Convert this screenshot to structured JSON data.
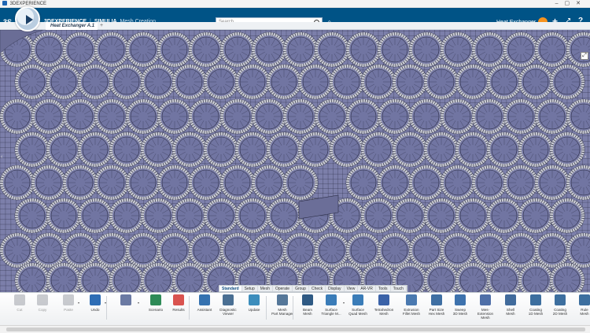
{
  "os_window": {
    "title": "3DEXPERIENCE"
  },
  "header": {
    "ds_logo": "3S",
    "brand_bold": "3DEXPERIENCE",
    "separator": "|",
    "brand_product": "SIMULIA",
    "app_name": "Mesh Creation",
    "search_placeholder": "Search",
    "space_title": "Heat Exchanger",
    "icons": [
      "compass-icon",
      "search-icon",
      "tag-icon",
      "user-avatar-icon",
      "add-icon",
      "share-icon",
      "help-icon"
    ],
    "colors": {
      "bar": "#005386",
      "avatar": "#f7931e"
    }
  },
  "document_tab": {
    "label": "Heat Exchanger A.1",
    "add_symbol": "+"
  },
  "viewport": {
    "model": "heat exchanger tube sheet mesh",
    "colors": {
      "mesh_fill": "#7c7faa",
      "mesh_line": "#2a2c45",
      "tube_ring": "#c9cbd4"
    }
  },
  "action_tabs": [
    {
      "label": "Standard",
      "active": true
    },
    {
      "label": "Setup",
      "active": false
    },
    {
      "label": "Mesh",
      "active": false
    },
    {
      "label": "Operate",
      "active": false
    },
    {
      "label": "Group",
      "active": false
    },
    {
      "label": "Check",
      "active": false
    },
    {
      "label": "Display",
      "active": false
    },
    {
      "label": "View",
      "active": false
    },
    {
      "label": "AR-VR",
      "active": false
    },
    {
      "label": "Tools",
      "active": false
    },
    {
      "label": "Touch",
      "active": false
    }
  ],
  "toolbar": {
    "tools": [
      {
        "label": "Cut",
        "icon": "scissors-icon",
        "disabled": true
      },
      {
        "label": "Copy",
        "icon": "copy-icon",
        "disabled": true
      },
      {
        "label": "Paste",
        "icon": "paste-icon",
        "disabled": true
      },
      {
        "label": "Undo",
        "icon": "undo-icon",
        "disabled": false
      },
      {
        "label": "",
        "icon": "shape-icon",
        "disabled": false
      },
      {
        "label": "Scenario",
        "icon": "scenario-icon",
        "disabled": false
      },
      {
        "label": "Results",
        "icon": "results-icon",
        "disabled": false
      },
      {
        "label": "Assistant",
        "icon": "assistant-icon",
        "disabled": false
      },
      {
        "label": "Diagnostic\nViewer",
        "icon": "diagnostic-icon",
        "disabled": false
      },
      {
        "label": "Update",
        "icon": "update-icon",
        "disabled": false
      },
      {
        "label": "Mesh\nPart Manager",
        "icon": "mesh-part-manager-icon",
        "disabled": false
      },
      {
        "label": "Beam\nMesh",
        "icon": "beam-mesh-icon",
        "disabled": false
      },
      {
        "label": "Surface\nTriangle M...",
        "icon": "surface-triangle-mesh-icon",
        "disabled": false
      },
      {
        "label": "Surface\nQuad Mesh",
        "icon": "surface-quad-mesh-icon",
        "disabled": false
      },
      {
        "label": "Tetrahedron\nMesh",
        "icon": "tetrahedron-mesh-icon",
        "disabled": false
      },
      {
        "label": "Extrusion\nFillet Mesh",
        "icon": "extrusion-fillet-mesh-icon",
        "disabled": false
      },
      {
        "label": "Part Size\nHex Mesh",
        "icon": "part-size-hex-mesh-icon",
        "disabled": false
      },
      {
        "label": "Sweep\n3D Mesh",
        "icon": "sweep-3d-mesh-icon",
        "disabled": false
      },
      {
        "label": "Mes-Extension\nMesh",
        "icon": "mes-extension-mesh-icon",
        "disabled": false
      },
      {
        "label": "Shell\nMesh",
        "icon": "shell-mesh-icon",
        "disabled": false
      },
      {
        "label": "Coating\n1D Mesh",
        "icon": "coating-1d-mesh-icon",
        "disabled": false
      },
      {
        "label": "Coating\n2D Mesh",
        "icon": "coating-2d-mesh-icon",
        "disabled": false
      },
      {
        "label": "Rule\nMesh",
        "icon": "rule-mesh-icon",
        "disabled": false
      }
    ]
  }
}
